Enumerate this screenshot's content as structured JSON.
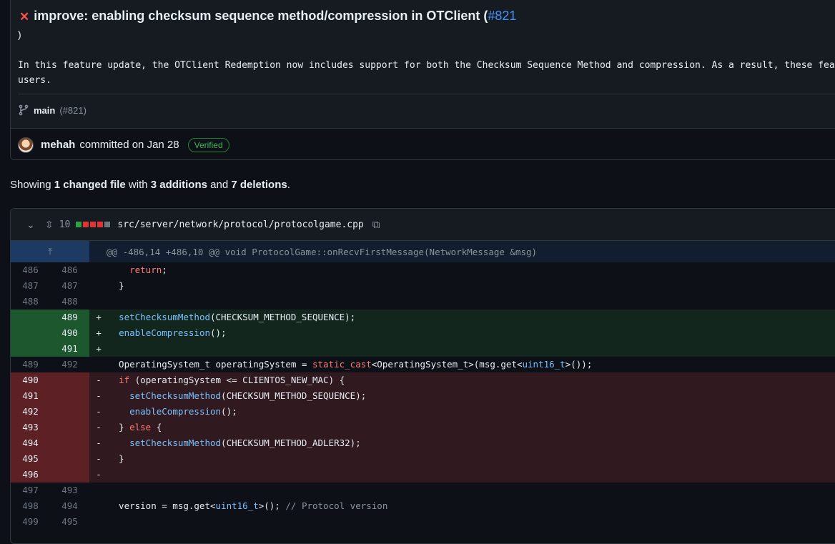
{
  "commit": {
    "title": "improve: enabling checksum sequence method/compression in OTClient (",
    "pr_ref": "#821",
    "title_cont": ")",
    "description_line1": "In this feature update, the OTClient Redemption now includes support for both the Checksum Sequence Method and compression. As a result, these fea",
    "description_line2": "users.",
    "branch": "main",
    "branch_pr": "(#821)",
    "author": "mehah",
    "committed_text": "committed on Jan 28",
    "verified_label": "Verified"
  },
  "summary": {
    "prefix": "Showing",
    "changed": "1 changed file",
    "with": "with",
    "additions": "3 additions",
    "and": "and",
    "deletions": "7 deletions",
    "end": "."
  },
  "file": {
    "change_count": "10",
    "path": "src/server/network/protocol/protocolgame.cpp",
    "hunk_header": "@@ -486,14 +486,10 @@ void ProtocolGame::onRecvFirstMessage(NetworkMessage &msg)",
    "block_colors": [
      "#2ea043",
      "#da3633",
      "#da3633",
      "#da3633",
      "#6e7681"
    ]
  },
  "diff_lines": [
    {
      "type": "ctx",
      "old": "486",
      "new": "486",
      "sign": "",
      "code": "    return;"
    },
    {
      "type": "ctx",
      "old": "487",
      "new": "487",
      "sign": "",
      "code": "  }"
    },
    {
      "type": "ctx",
      "old": "488",
      "new": "488",
      "sign": "",
      "code": ""
    },
    {
      "type": "add",
      "old": "",
      "new": "489",
      "sign": "+",
      "code": "  setChecksumMethod(CHECKSUM_METHOD_SEQUENCE);"
    },
    {
      "type": "add",
      "old": "",
      "new": "490",
      "sign": "+",
      "code": "  enableCompression();"
    },
    {
      "type": "add",
      "old": "",
      "new": "491",
      "sign": "+",
      "code": ""
    },
    {
      "type": "ctx",
      "old": "489",
      "new": "492",
      "sign": "",
      "code": "  OperatingSystem_t operatingSystem = static_cast<OperatingSystem_t>(msg.get<uint16_t>());"
    },
    {
      "type": "del",
      "old": "490",
      "new": "",
      "sign": "-",
      "code": "  if (operatingSystem <= CLIENTOS_NEW_MAC) {"
    },
    {
      "type": "del",
      "old": "491",
      "new": "",
      "sign": "-",
      "code": "    setChecksumMethod(CHECKSUM_METHOD_SEQUENCE);"
    },
    {
      "type": "del",
      "old": "492",
      "new": "",
      "sign": "-",
      "code": "    enableCompression();"
    },
    {
      "type": "del",
      "old": "493",
      "new": "",
      "sign": "-",
      "code": "  } else {"
    },
    {
      "type": "del",
      "old": "494",
      "new": "",
      "sign": "-",
      "code": "    setChecksumMethod(CHECKSUM_METHOD_ADLER32);"
    },
    {
      "type": "del",
      "old": "495",
      "new": "",
      "sign": "-",
      "code": "  }"
    },
    {
      "type": "del",
      "old": "496",
      "new": "",
      "sign": "-",
      "code": ""
    },
    {
      "type": "ctx",
      "old": "497",
      "new": "493",
      "sign": "",
      "code": ""
    },
    {
      "type": "ctx",
      "old": "498",
      "new": "494",
      "sign": "",
      "code": "  version = msg.get<uint16_t>(); // Protocol version"
    },
    {
      "type": "ctx",
      "old": "499",
      "new": "495",
      "sign": "",
      "code": ""
    }
  ]
}
